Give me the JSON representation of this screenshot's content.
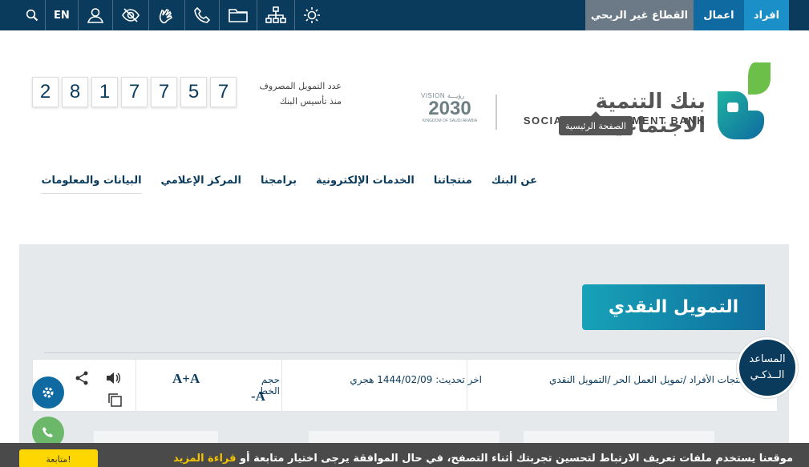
{
  "topbar": {
    "segments": {
      "individuals": "افراد",
      "business": "اعمال",
      "nonprofit": "القطاع غير الربحي"
    },
    "lang": "EN",
    "icons": [
      "search-icon",
      "user-icon",
      "visibility-icon",
      "sign-language-icon",
      "phone-icon",
      "folder-icon",
      "sitemap-icon",
      "sun-icon"
    ]
  },
  "brand": {
    "name_ar": "بنك التنمية الاجتماعية",
    "name_en": "SOCIAL DEVELOPMENT BANK",
    "tooltip": "الصفحة الرئيسية",
    "vision_top": "VISION",
    "vision_ar": "رؤيـــة",
    "vision_year": "2030",
    "vision_sub": "KINGDOM OF SAUDI ARABIA"
  },
  "counter": {
    "digits": [
      "2",
      "8",
      "1",
      "7",
      "7",
      "5",
      "7"
    ],
    "label_line1": "عدد التمويل المصروف",
    "label_line2": "منذ تأسيس البنك"
  },
  "nav": [
    "عن البنك",
    "منتجاتنا",
    "الخدمات الإلكترونية",
    "برامجنا",
    "المركز الإعلامي",
    "البيانات والمعلومات"
  ],
  "page": {
    "title": "التمويل النقدي",
    "breadcrumb": "نا /منتجات الأفراد /تمويل العمل الحر /التمويل النقدي",
    "updated": "اخر تحديث: 1444/02/09 هجري",
    "font_label": "حجم الخط",
    "font_up": "A+A",
    "font_down": "-A"
  },
  "assistant": {
    "line1": "المساعد",
    "line2": "الــذكـي"
  },
  "cookie": {
    "text": "موقعنا يستخدم ملفات تعريف الارتباط لتحسين تجربتك أثناء التصفح، في حال الموافقة يرجى اختيار متابعة أو ",
    "more": "قراءة المزيد",
    "button": "متابعة!"
  }
}
